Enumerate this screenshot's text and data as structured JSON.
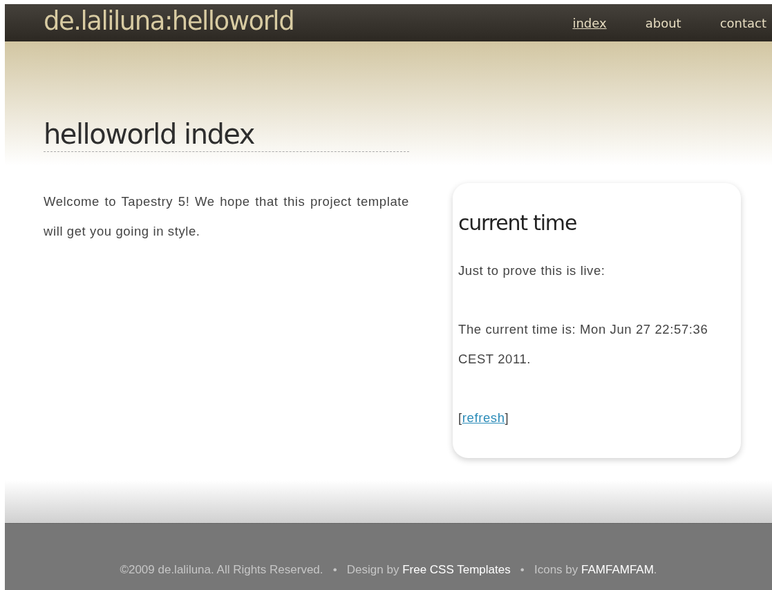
{
  "header": {
    "logo": "de.laliluna:helloworld",
    "nav": [
      {
        "label": "index",
        "selected": true
      },
      {
        "label": "about",
        "selected": false
      },
      {
        "label": "contact",
        "selected": false
      }
    ]
  },
  "page_title": "helloworld index",
  "intro": "Welcome to Tapestry 5! We hope that this project template will get you going in style.",
  "sidebar": {
    "title": "current time",
    "paragraphs": [
      "Just to prove this is live:",
      "The current time is: Mon Jun 27 22:57:36 CEST 2011."
    ],
    "refresh": [
      {
        "kind": "text",
        "text": "["
      },
      {
        "kind": "link",
        "text": "refresh"
      },
      {
        "kind": "text",
        "text": "]"
      }
    ]
  },
  "footer": [
    {
      "kind": "text",
      "text": "©2009 de.laliluna. All Rights Reserved.   •   Design by "
    },
    {
      "kind": "link",
      "text": "Free CSS Templates"
    },
    {
      "kind": "text",
      "text": "   •   Icons by "
    },
    {
      "kind": "link",
      "text": "FAMFAMFAM"
    },
    {
      "kind": "text",
      "text": "."
    }
  ]
}
